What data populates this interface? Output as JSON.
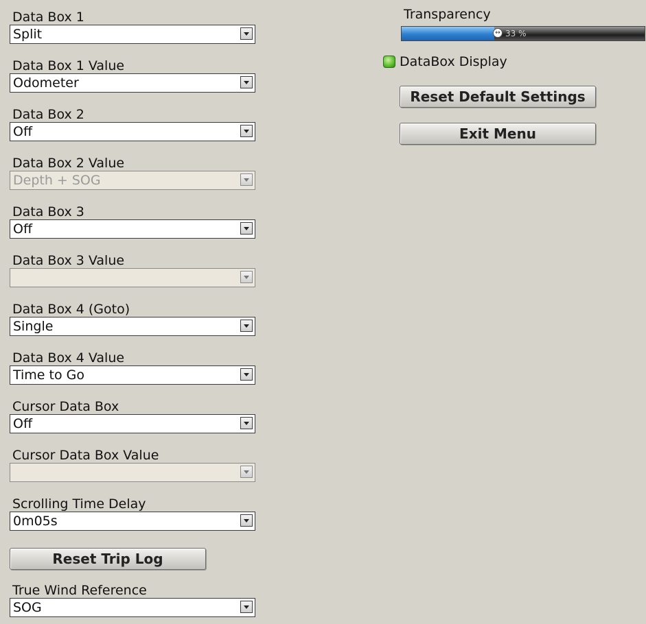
{
  "fields": [
    {
      "label": "Data Box 1",
      "value": "Split",
      "disabled": false
    },
    {
      "label": "Data Box 1 Value",
      "value": "Odometer",
      "disabled": false
    },
    {
      "label": "Data Box 2",
      "value": "Off",
      "disabled": false
    },
    {
      "label": "Data Box 2 Value",
      "value": "Depth + SOG",
      "disabled": true
    },
    {
      "label": "Data Box 3",
      "value": "Off",
      "disabled": false
    },
    {
      "label": "Data Box 3 Value",
      "value": "",
      "disabled": true
    },
    {
      "label": "Data Box 4 (Goto)",
      "value": "Single",
      "disabled": false
    },
    {
      "label": "Data Box 4 Value",
      "value": "Time to Go",
      "disabled": false
    },
    {
      "label": "Cursor Data Box",
      "value": "Off",
      "disabled": false
    },
    {
      "label": "Cursor Data Box Value",
      "value": "",
      "disabled": true
    },
    {
      "label": "Scrolling Time Delay",
      "value": "0m05s",
      "disabled": false
    }
  ],
  "true_wind": {
    "label": "True Wind Reference",
    "value": "SOG"
  },
  "buttons": {
    "reset_trip_log": "Reset Trip Log",
    "reset_defaults": "Reset Default Settings",
    "exit_menu": "Exit Menu"
  },
  "transparency": {
    "label": "Transparency",
    "value_text": "33 %",
    "level": 0.38
  },
  "databox_display": {
    "label": "DataBox Display",
    "checked": true
  },
  "colors": {
    "background": "#d6d3cb",
    "slider_fill": "#2d7fd0",
    "toggle_on": "#53b824"
  },
  "icons": {
    "dropdown": "chevron-down-icon",
    "slider_thumb": "slider-thumb-icon",
    "toggle": "checkbox-led-icon"
  }
}
